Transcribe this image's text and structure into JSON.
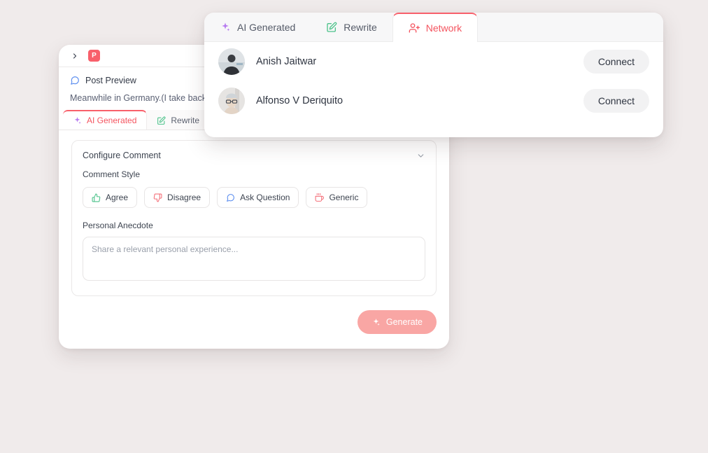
{
  "left_panel": {
    "topbar": {
      "expand_icon": "chevron-right-icon",
      "logo_letter": "P"
    },
    "preview": {
      "icon": "speech-bubble-icon",
      "title": "Post Preview",
      "text": "Meanwhile in Germany.(I take back a"
    },
    "tabs": [
      {
        "label": "AI Generated",
        "icon": "sparkle-icon",
        "active": true
      },
      {
        "label": "Rewrite",
        "icon": "edit-square-icon",
        "active": false
      }
    ],
    "configure": {
      "title": "Configure Comment",
      "collapse_icon": "chevron-down-icon",
      "comment_style_label": "Comment Style",
      "styles": [
        {
          "label": "Agree",
          "icon": "thumbs-up-icon",
          "color": "#4cc28a"
        },
        {
          "label": "Disagree",
          "icon": "thumbs-down-icon",
          "color": "#f4707a"
        },
        {
          "label": "Ask Question",
          "icon": "question-bubble-icon",
          "color": "#5b8def"
        },
        {
          "label": "Generic",
          "icon": "coffee-cup-icon",
          "color": "#f4707a"
        }
      ],
      "anecdote_label": "Personal Anecdote",
      "anecdote_value": "",
      "anecdote_placeholder": "Share a relevant personal experience..."
    },
    "generate": {
      "label": "Generate",
      "icon": "sparkle-icon",
      "color": "#f9a6a4"
    }
  },
  "network_panel": {
    "tabs": [
      {
        "label": "AI Generated",
        "icon": "sparkle-icon",
        "active": false
      },
      {
        "label": "Rewrite",
        "icon": "edit-square-icon",
        "active": false
      },
      {
        "label": "Network",
        "icon": "person-add-icon",
        "active": true
      }
    ],
    "people": [
      {
        "name": "Anish Jaitwar",
        "action_label": "Connect"
      },
      {
        "name": "Alfonso V Deriquito",
        "action_label": "Connect"
      }
    ]
  },
  "colors": {
    "background": "#f0ebeb",
    "accent_red": "#f4545f",
    "logo_red": "#f8606b",
    "generate_red": "#f9a6a4",
    "sparkle_purple": "#b77cf0",
    "rewrite_green": "#4cc28a"
  }
}
